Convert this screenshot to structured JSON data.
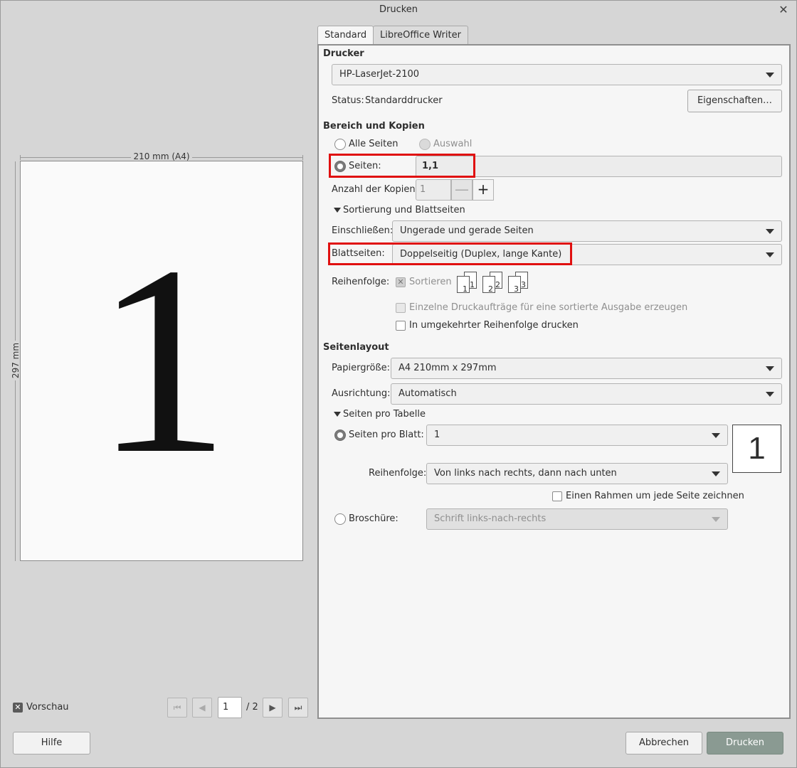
{
  "window": {
    "title": "Drucken"
  },
  "preview": {
    "width_label": "210 mm (A4)",
    "height_label": "297 mm",
    "page_content": "1",
    "preview_toggle_label": "Vorschau",
    "current_page": "1",
    "total_pages": "/ 2"
  },
  "tabs": [
    {
      "label": "Standard",
      "active": true
    },
    {
      "label": "LibreOffice Writer",
      "active": false
    }
  ],
  "printer": {
    "section_title": "Drucker",
    "selected": "HP-LaserJet-2100",
    "status_label": "Status:",
    "status_value": "Standarddrucker",
    "properties_button": "Eigenschaften…"
  },
  "range": {
    "section_title": "Bereich und Kopien",
    "all_pages_label": "Alle Seiten",
    "selection_label": "Auswahl",
    "pages_label": "Seiten:",
    "pages_value": "1,1",
    "copies_label": "Anzahl der Kopien:",
    "copies_value": "1",
    "minus": "—",
    "plus": "+"
  },
  "sorting": {
    "expander_label": "Sortierung und Blattseiten",
    "include_label": "Einschließen:",
    "include_value": "Ungerade und gerade Seiten",
    "sides_label": "Blattseiten:",
    "sides_value": "Doppelseitig (Duplex, lange Kante)",
    "order_label": "Reihenfolge:",
    "collate_label": "Sortieren",
    "collate_icons": [
      "1",
      "1",
      "2",
      "2",
      "3",
      "3"
    ],
    "separate_jobs_label": "Einzelne Druckaufträge für eine sortierte Ausgabe erzeugen",
    "reverse_label": "In umgekehrter Reihenfolge drucken"
  },
  "layout": {
    "section_title": "Seitenlayout",
    "paper_label": "Papiergröße:",
    "paper_value": "A4 210mm x 297mm",
    "orientation_label": "Ausrichtung:",
    "orientation_value": "Automatisch",
    "expander_label": "Seiten pro Tabelle",
    "pages_per_sheet_label": "Seiten pro Blatt:",
    "pages_per_sheet_value": "1",
    "nup_preview": "1",
    "order_label": "Reihenfolge:",
    "order_value": "Von links nach rechts, dann nach unten",
    "border_label": "Einen Rahmen um jede Seite zeichnen",
    "brochure_label": "Broschüre:",
    "brochure_value": "Schrift links-nach-rechts"
  },
  "buttons": {
    "help": "Hilfe",
    "cancel": "Abbrechen",
    "print": "Drucken"
  },
  "colors": {
    "highlight": "#e01010",
    "primary_button": "#8a9a92",
    "window_bg": "#d6d6d6"
  }
}
